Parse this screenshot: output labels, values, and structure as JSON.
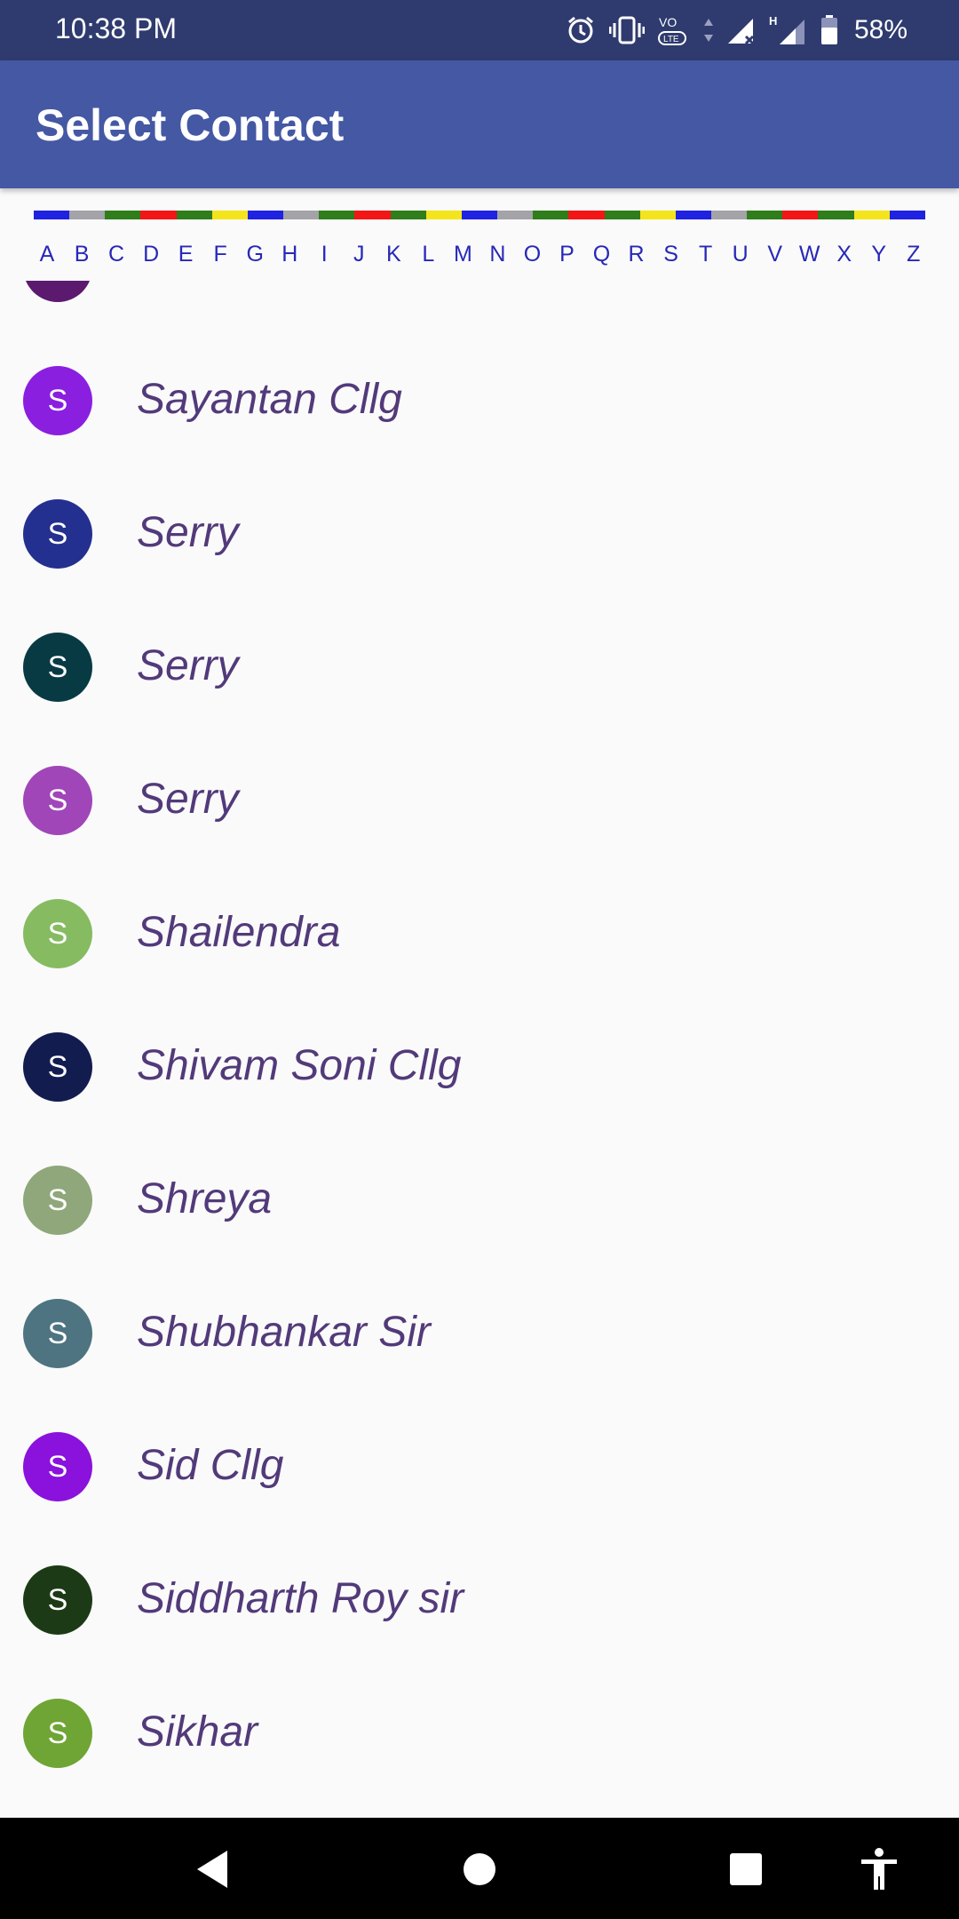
{
  "status_bar": {
    "time": "10:38 PM",
    "battery": "58%",
    "icons": [
      "alarm-icon",
      "vibrate-icon",
      "volte-icon",
      "signal-icon",
      "signal-h-icon",
      "battery-icon"
    ]
  },
  "app_bar": {
    "title": "Select Contact"
  },
  "alphabet_index": {
    "letters": [
      "A",
      "B",
      "C",
      "D",
      "E",
      "F",
      "G",
      "H",
      "I",
      "J",
      "K",
      "L",
      "M",
      "N",
      "O",
      "P",
      "Q",
      "R",
      "S",
      "T",
      "U",
      "V",
      "W",
      "X",
      "Y",
      "Z"
    ],
    "strip_colors": [
      "#1f22e0",
      "#a3a3a8",
      "#2f7d1b",
      "#f21616",
      "#2f7d1b",
      "#f4e41c",
      "#1f22e0",
      "#a3a3a8",
      "#2f7d1b",
      "#f21616",
      "#2f7d1b",
      "#f4e41c",
      "#1f22e0",
      "#a3a3a8",
      "#2f7d1b",
      "#f21616",
      "#2f7d1b",
      "#f4e41c",
      "#1f22e0",
      "#a3a3a8",
      "#2f7d1b",
      "#f21616",
      "#2f7d1b",
      "#f4e41c",
      "#1f22e0"
    ]
  },
  "contacts": [
    {
      "initial": "S",
      "name": "Sayantan Cllg",
      "color": "#8a1fe0"
    },
    {
      "initial": "S",
      "name": "Serry",
      "color": "#23308f"
    },
    {
      "initial": "S",
      "name": "Serry",
      "color": "#083a44"
    },
    {
      "initial": "S",
      "name": "Serry",
      "color": "#a046b8"
    },
    {
      "initial": "S",
      "name": "Shailendra",
      "color": "#86bb62"
    },
    {
      "initial": "S",
      "name": "Shivam Soni Cllg",
      "color": "#121c4f"
    },
    {
      "initial": "S",
      "name": "Shreya",
      "color": "#8fa77a"
    },
    {
      "initial": "S",
      "name": "Shubhankar Sir",
      "color": "#4d7480"
    },
    {
      "initial": "S",
      "name": "Sid Cllg",
      "color": "#8a12dc"
    },
    {
      "initial": "S",
      "name": "Siddharth Roy sir",
      "color": "#1c3a16"
    },
    {
      "initial": "S",
      "name": "Sikhar",
      "color": "#6fa534"
    }
  ],
  "nav_bar": {
    "buttons": [
      "back-icon",
      "home-icon",
      "recents-icon",
      "accessibility-icon"
    ]
  }
}
